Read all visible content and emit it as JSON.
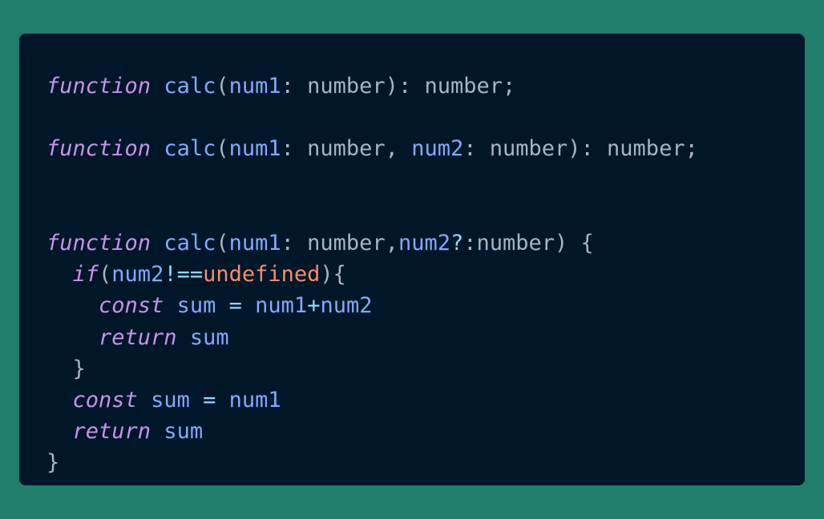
{
  "code": {
    "lines": [
      [
        {
          "t": "function",
          "c": "kw"
        },
        {
          "t": " ",
          "c": "plain"
        },
        {
          "t": "calc",
          "c": "fn"
        },
        {
          "t": "(",
          "c": "plain"
        },
        {
          "t": "num1",
          "c": "id"
        },
        {
          "t": ": number): number;",
          "c": "plain"
        }
      ],
      [],
      [
        {
          "t": "function",
          "c": "kw"
        },
        {
          "t": " ",
          "c": "plain"
        },
        {
          "t": "calc",
          "c": "fn"
        },
        {
          "t": "(",
          "c": "plain"
        },
        {
          "t": "num1",
          "c": "id"
        },
        {
          "t": ": number, ",
          "c": "plain"
        },
        {
          "t": "num2",
          "c": "id"
        },
        {
          "t": ": number): number;",
          "c": "plain"
        }
      ],
      [],
      [],
      [
        {
          "t": "function",
          "c": "kw"
        },
        {
          "t": " ",
          "c": "plain"
        },
        {
          "t": "calc",
          "c": "fn"
        },
        {
          "t": "(",
          "c": "plain"
        },
        {
          "t": "num1",
          "c": "id"
        },
        {
          "t": ": number,",
          "c": "plain"
        },
        {
          "t": "num2",
          "c": "id"
        },
        {
          "t": "?",
          "c": "op"
        },
        {
          "t": ":number) {",
          "c": "plain"
        }
      ],
      [
        {
          "t": "  ",
          "c": "plain"
        },
        {
          "t": "if",
          "c": "kw"
        },
        {
          "t": "(",
          "c": "plain"
        },
        {
          "t": "num2",
          "c": "id"
        },
        {
          "t": "!==",
          "c": "op"
        },
        {
          "t": "undefined",
          "c": "lit"
        },
        {
          "t": "){",
          "c": "plain"
        }
      ],
      [
        {
          "t": "    ",
          "c": "plain"
        },
        {
          "t": "const",
          "c": "kw"
        },
        {
          "t": " ",
          "c": "plain"
        },
        {
          "t": "sum",
          "c": "id"
        },
        {
          "t": " ",
          "c": "plain"
        },
        {
          "t": "=",
          "c": "op"
        },
        {
          "t": " ",
          "c": "plain"
        },
        {
          "t": "num1",
          "c": "id"
        },
        {
          "t": "+",
          "c": "op"
        },
        {
          "t": "num2",
          "c": "id"
        }
      ],
      [
        {
          "t": "    ",
          "c": "plain"
        },
        {
          "t": "return",
          "c": "kw"
        },
        {
          "t": " ",
          "c": "plain"
        },
        {
          "t": "sum",
          "c": "id"
        }
      ],
      [
        {
          "t": "  }",
          "c": "plain"
        }
      ],
      [
        {
          "t": "  ",
          "c": "plain"
        },
        {
          "t": "const",
          "c": "kw"
        },
        {
          "t": " ",
          "c": "plain"
        },
        {
          "t": "sum",
          "c": "id"
        },
        {
          "t": " ",
          "c": "plain"
        },
        {
          "t": "=",
          "c": "op"
        },
        {
          "t": " ",
          "c": "plain"
        },
        {
          "t": "num1",
          "c": "id"
        }
      ],
      [
        {
          "t": "  ",
          "c": "plain"
        },
        {
          "t": "return",
          "c": "kw"
        },
        {
          "t": " ",
          "c": "plain"
        },
        {
          "t": "sum",
          "c": "id"
        }
      ],
      [
        {
          "t": "}",
          "c": "plain"
        }
      ]
    ]
  },
  "colors": {
    "background": "#1f7f6c",
    "panel": "#001729",
    "keyword": "#c792ea",
    "identifier": "#82aaff",
    "operator": "#89ddff",
    "literal": "#f78c6c",
    "plain": "#a7b5c3"
  }
}
